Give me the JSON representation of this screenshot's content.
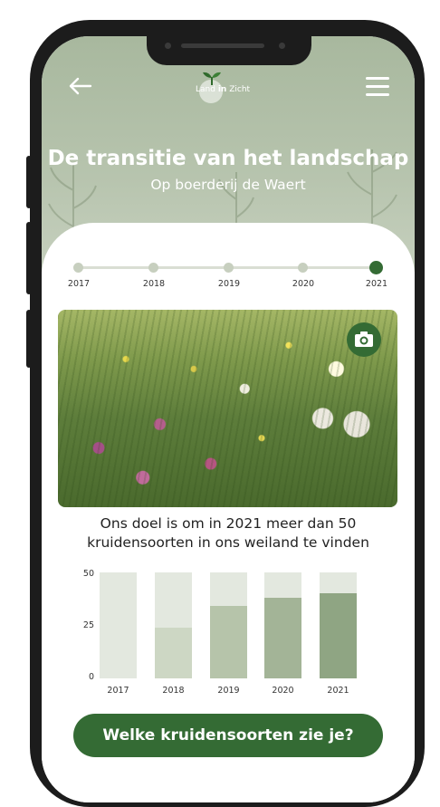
{
  "header": {
    "logo_text_start": "Land",
    "logo_text_mid": "in",
    "logo_text_end": "Zicht",
    "title": "De transitie van het landschap",
    "subtitle": "Op boerderij de Waert"
  },
  "icons": {
    "back": "arrow-left-icon",
    "menu": "hamburger-menu-icon",
    "camera": "camera-icon"
  },
  "colors": {
    "accent": "#346b34",
    "header_bg": "#a8b89e"
  },
  "timeline": {
    "years": [
      "2017",
      "2018",
      "2019",
      "2020",
      "2021"
    ],
    "active_year": "2021"
  },
  "goal_text_line1": "Ons doel is om in 2021 meer dan 50",
  "goal_text_line2": "kruidensoorten in ons weiland te vinden",
  "chart_data": {
    "type": "bar",
    "categories": [
      "2017",
      "2018",
      "2019",
      "2020",
      "2021"
    ],
    "values": [
      0,
      24,
      34,
      38,
      40
    ],
    "ylim": [
      0,
      50
    ],
    "yticks": [
      "50",
      "25",
      "0"
    ],
    "colors": [
      "#e3e8df",
      "#cdd7c4",
      "#b6c4aa",
      "#a3b497",
      "#8fa583"
    ]
  },
  "cta_label": "Welke kruidensoorten zie je?"
}
